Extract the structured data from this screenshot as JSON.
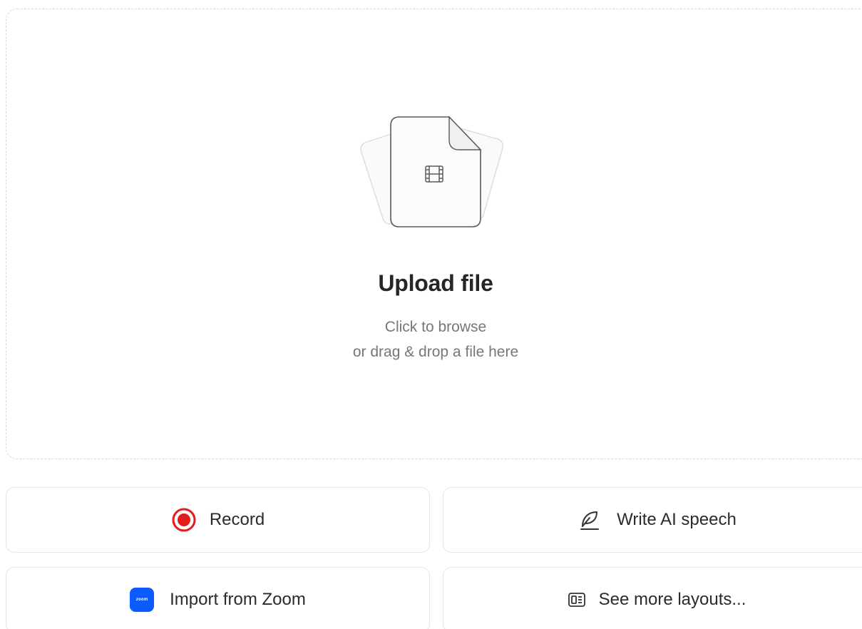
{
  "upload": {
    "title": "Upload file",
    "line1": "Click to browse",
    "line2": "or drag & drop a file here",
    "icon": "film-file-icon"
  },
  "actions": {
    "record": {
      "label": "Record",
      "icon": "record-icon",
      "color": "#e31b1b"
    },
    "speech": {
      "label": "Write AI speech",
      "icon": "feather-pen-icon"
    },
    "zoom": {
      "label": "Import from Zoom",
      "icon": "zoom-logo-icon",
      "logo_text": "zoom",
      "color": "#0b5cff"
    },
    "layouts": {
      "label": "See more layouts...",
      "icon": "layout-icon"
    }
  }
}
